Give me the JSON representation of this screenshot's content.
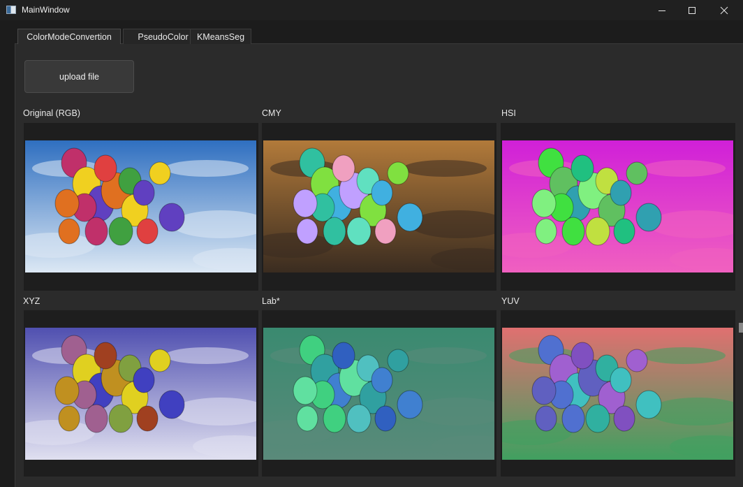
{
  "window": {
    "title": "MainWindow",
    "icon": "app-window-icon",
    "controls": [
      "minimize-icon",
      "maximize-icon",
      "close-icon"
    ]
  },
  "tabs": [
    {
      "label": "ColorModeConvertion",
      "active": true
    },
    {
      "label": "PseudoColor",
      "active": false
    },
    {
      "label": "KMeansSeg",
      "active": false
    }
  ],
  "upload": {
    "label": "upload file"
  },
  "images": [
    {
      "label": "Original (RGB)",
      "sky": [
        "#2f6fc0",
        "#dce8f4"
      ],
      "balloons": [
        "#c0306a",
        "#f0d020",
        "#6040c0",
        "#e07020",
        "#40a040",
        "#e04040"
      ]
    },
    {
      "label": "CMY",
      "sky": [
        "#b27a3a",
        "#3a2c20"
      ],
      "balloons": [
        "#30c0a0",
        "#80e040",
        "#40b0e0",
        "#c0a0ff",
        "#60e0c0",
        "#f0a0c0"
      ]
    },
    {
      "label": "HSI",
      "sky": [
        "#d020d8",
        "#f060c0"
      ],
      "balloons": [
        "#40e040",
        "#60c060",
        "#30a0b0",
        "#80f080",
        "#c0e040",
        "#20c080"
      ]
    },
    {
      "label": "XYZ",
      "sky": [
        "#5050b0",
        "#e0e0f0"
      ],
      "balloons": [
        "#a06090",
        "#e0d020",
        "#4040c0",
        "#c09020",
        "#80a040",
        "#a04020"
      ]
    },
    {
      "label": "Lab*",
      "sky": [
        "#3a8a70",
        "#5a8a7a"
      ],
      "balloons": [
        "#40d080",
        "#30a0a0",
        "#4080d0",
        "#60e0a0",
        "#50c0c0",
        "#3060c0"
      ]
    },
    {
      "label": "YUV",
      "sky": [
        "#e07070",
        "#40a060"
      ],
      "balloons": [
        "#5070d0",
        "#a060d0",
        "#40c0c0",
        "#6060c0",
        "#30b0a0",
        "#8050c0"
      ]
    }
  ]
}
